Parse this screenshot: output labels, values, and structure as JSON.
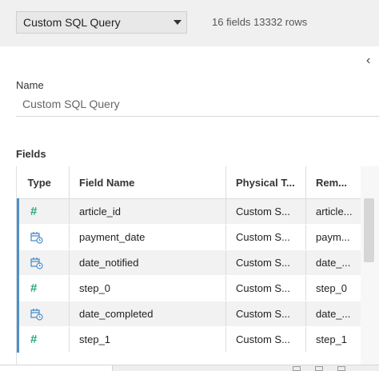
{
  "toolbar": {
    "source_select_value": "Custom SQL Query",
    "stats": "16 fields 13332 rows"
  },
  "details": {
    "name_label": "Name",
    "name_value": "Custom SQL Query",
    "fields_label": "Fields"
  },
  "table": {
    "headers": [
      "Type",
      "Field Name",
      "Physical T...",
      "Rem..."
    ],
    "rows": [
      {
        "type": "number-icon",
        "field_name": "article_id",
        "physical_table": "Custom S...",
        "remote": "article..."
      },
      {
        "type": "date-icon",
        "field_name": "payment_date",
        "physical_table": "Custom S...",
        "remote": "paym..."
      },
      {
        "type": "date-icon",
        "field_name": "date_notified",
        "physical_table": "Custom S...",
        "remote": "date_..."
      },
      {
        "type": "number-icon",
        "field_name": "step_0",
        "physical_table": "Custom S...",
        "remote": "step_0"
      },
      {
        "type": "date-icon",
        "field_name": "date_completed",
        "physical_table": "Custom S...",
        "remote": "date_..."
      },
      {
        "type": "number-icon",
        "field_name": "step_1",
        "physical_table": "Custom S...",
        "remote": "step_1"
      }
    ]
  },
  "colors": {
    "accent": "#4e8fc9",
    "number_icon": "#2aa77a",
    "date_icon": "#4e8fc9"
  }
}
